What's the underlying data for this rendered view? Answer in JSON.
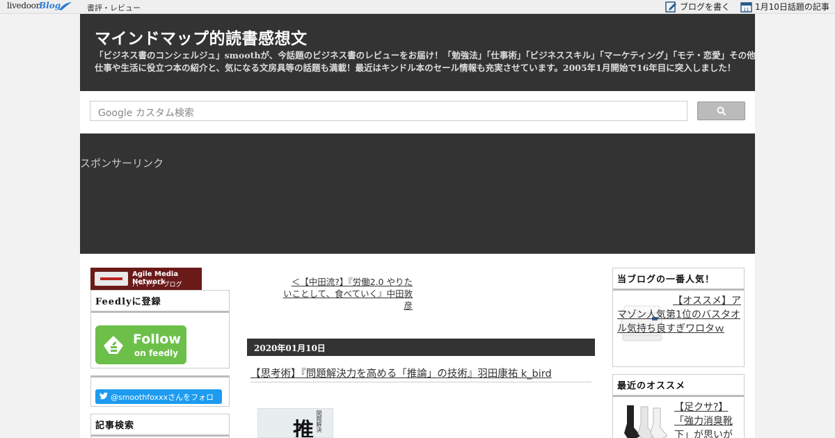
{
  "topbar": {
    "logo_text": "livedoor",
    "logo_blog": "Blog",
    "category": "書評・レビュー",
    "write_label": "ブログを書く",
    "date_label": "1月10日話題の記事"
  },
  "header": {
    "title": "マインドマップ的読書感想文",
    "description": "「ビジネス書のコンシェルジュ」smoothが、今話題のビジネス書のレビューをお届け！「勉強法」「仕事術」「ビジネススキル」「マーケティング」「モテ・恋愛」その他仕事や生活に役立つ本の紹介と、気になる文房具等の話題も満載！最近はキンドル本のセール情報も充実させています。2005年1月開始で16年目に突入しました！"
  },
  "search": {
    "placeholder": "Google カスタム検索"
  },
  "sponsor": {
    "label": "スポンサーリンク"
  },
  "left_sidebar": {
    "amn_title": "Agile Media Network",
    "amn_sub": "パートナーブログ",
    "feedly_heading": "Feedlyに登録",
    "feedly_follow": "Follow",
    "feedly_on": "on feedly",
    "twitter_label": "@smoothfoxxxさんをフォロー",
    "search_heading": "記事検索"
  },
  "article": {
    "prev_link": "＜【中田流?】『労働2.0 やりたいことして、食べていく』中田敦彦",
    "date": "2020年01月10日",
    "title": "【思考術】『問題解決力を高める「推論」の技術』羽田康祐 k_bird",
    "book_big": "推",
    "book_small": "問題解決"
  },
  "right_sidebar": {
    "popular_heading": "当ブログの一番人気！",
    "popular_link": "【オススメ】アマゾン人気第1位のバスタオル気持ち良すぎワロタｗ",
    "recommend_heading": "最近のオススメ",
    "recommend_link": "【足クサ?】「強力消臭靴下」が思いが"
  },
  "colors": {
    "header_bg": "#333333",
    "feedly_green": "#6cc04a",
    "twitter_blue": "#1d9bf0",
    "amn_red": "#6b1a1a"
  }
}
